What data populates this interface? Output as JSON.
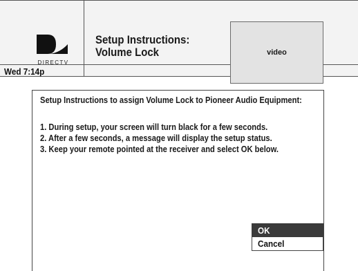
{
  "brand": {
    "logo_text": "DIRECTV"
  },
  "header": {
    "title_line1": "Setup Instructions:",
    "title_line2": "Volume Lock",
    "video_label": "video",
    "time": "Wed 7:14p"
  },
  "panel": {
    "heading": "Setup Instructions to assign Volume Lock to Pioneer Audio Equipment:",
    "steps": [
      "1. During setup, your screen will turn black for a few seconds.",
      "2. After a few seconds, a message will display the setup status.",
      "3. Keep your remote pointed at the receiver and select OK below."
    ]
  },
  "menu": {
    "items": [
      {
        "label": "OK",
        "selected": true
      },
      {
        "label": "Cancel",
        "selected": false
      }
    ]
  },
  "colors": {
    "header_bg": "#f3f3f3",
    "video_bg": "#e3e3e3",
    "selected_bg": "#3a3a3a",
    "selected_text": "#ffffff"
  }
}
